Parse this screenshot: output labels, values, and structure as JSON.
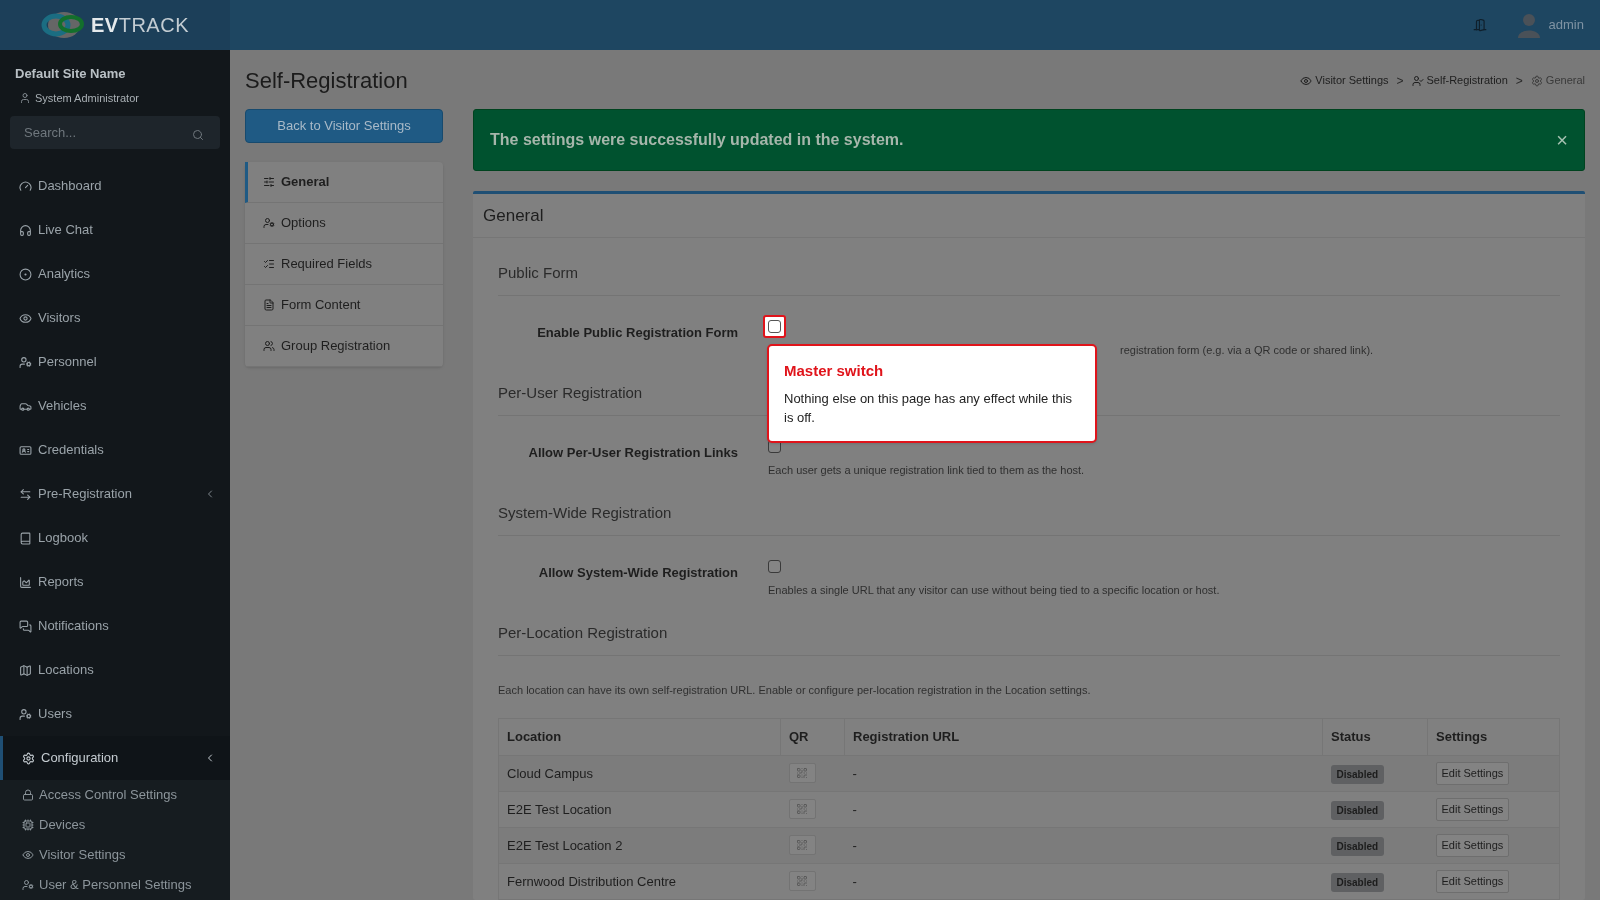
{
  "header": {
    "logo": {
      "bold": "EV",
      "light": "TRACK"
    },
    "user": "admin"
  },
  "sidebar": {
    "site_name": "Default Site Name",
    "role": "System Administrator",
    "search": {
      "placeholder": "Search..."
    },
    "items": [
      {
        "label": "Dashboard",
        "selected": false
      },
      {
        "label": "Live Chat",
        "selected": false
      },
      {
        "label": "Analytics",
        "selected": false
      },
      {
        "label": "Visitors",
        "selected": false
      },
      {
        "label": "Personnel",
        "selected": false
      },
      {
        "label": "Vehicles",
        "selected": false
      },
      {
        "label": "Credentials",
        "selected": false
      },
      {
        "label": "Pre-Registration",
        "selected": false,
        "expanded": false
      },
      {
        "label": "Logbook",
        "selected": false
      },
      {
        "label": "Reports",
        "selected": false
      },
      {
        "label": "Notifications",
        "selected": false
      },
      {
        "label": "Locations",
        "selected": false
      },
      {
        "label": "Users",
        "selected": false
      },
      {
        "label": "Configuration",
        "selected": true,
        "expanded": true,
        "children": [
          {
            "label": "Access Control Settings"
          },
          {
            "label": "Devices"
          },
          {
            "label": "Visitor Settings"
          },
          {
            "label": "User & Personnel Settings"
          }
        ]
      }
    ]
  },
  "page": {
    "title": "Self-Registration",
    "back_button": "Back to Visitor Settings",
    "breadcrumbs": [
      {
        "label": "Visitor Settings"
      },
      {
        "label": "Self-Registration"
      },
      {
        "label": "General"
      }
    ],
    "breadcrumb_separator": ">",
    "tabs": [
      {
        "label": "General",
        "selected": true
      },
      {
        "label": "Options",
        "selected": false
      },
      {
        "label": "Required Fields",
        "selected": false
      },
      {
        "label": "Form Content",
        "selected": false
      },
      {
        "label": "Group Registration",
        "selected": false
      }
    ],
    "alert": {
      "text": "The settings were successfully updated in the system.",
      "dismiss": "×"
    },
    "panel": {
      "title": "General",
      "sections": [
        {
          "heading": "Public Form",
          "rows": [
            {
              "label": "Enable Public Registration Form",
              "checked": false,
              "highlighted": true,
              "help": "registration form (e.g. via a QR code or shared link)."
            }
          ]
        },
        {
          "heading": "Per-User Registration",
          "rows": [
            {
              "label": "Allow Per-User Registration Links",
              "checked": false,
              "highlighted": false,
              "help": "Each user gets a unique registration link tied to them as the host."
            }
          ]
        },
        {
          "heading": "System-Wide Registration",
          "rows": [
            {
              "label": "Allow System-Wide Registration",
              "checked": false,
              "highlighted": false,
              "help": "Enables a single URL that any visitor can use without being tied to a specific location or host."
            }
          ]
        }
      ],
      "locations": {
        "heading": "Per-Location Registration",
        "note": "Each location can have its own self-registration URL. Enable or configure per-location registration in the Location settings.",
        "columns": [
          "Location",
          "QR",
          "Registration URL",
          "Status",
          "Settings"
        ],
        "rows": [
          {
            "location": "Cloud Campus",
            "url": "-",
            "status": "Disabled",
            "action": "Edit Settings"
          },
          {
            "location": "E2E Test Location",
            "url": "-",
            "status": "Disabled",
            "action": "Edit Settings"
          },
          {
            "location": "E2E Test Location 2",
            "url": "-",
            "status": "Disabled",
            "action": "Edit Settings"
          },
          {
            "location": "Fernwood Distribution Centre",
            "url": "-",
            "status": "Disabled",
            "action": "Edit Settings"
          }
        ]
      }
    }
  },
  "tour": {
    "title": "Master switch",
    "body": "Nothing else on this page has any effect while this is off."
  }
}
